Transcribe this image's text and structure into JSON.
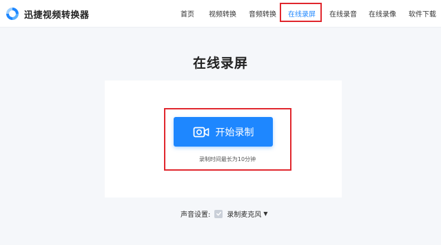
{
  "brand": {
    "name": "迅捷视频转换器",
    "accent_color": "#1e87ff"
  },
  "nav": {
    "items": [
      {
        "label": "首页"
      },
      {
        "label": "视频转换"
      },
      {
        "label": "音频转换"
      },
      {
        "label": "在线录屏",
        "active": true
      },
      {
        "label": "在线录音"
      },
      {
        "label": "在线录像"
      },
      {
        "label": "软件下载"
      }
    ]
  },
  "main": {
    "title": "在线录屏",
    "record_button": {
      "label": "开始录制",
      "icon": "video-camera-icon"
    },
    "hint": "录制时间最长为10分钟"
  },
  "audio": {
    "label": "声音设置:",
    "mic_label": "录制麦克风",
    "mic_checked": true
  },
  "highlight_color": "#e0262d"
}
